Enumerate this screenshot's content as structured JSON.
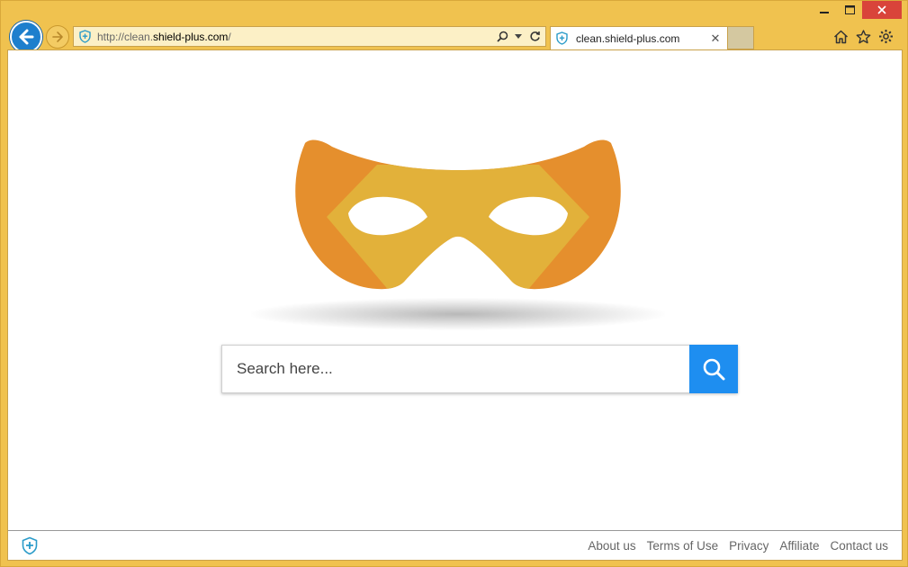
{
  "browser": {
    "address": {
      "url_prefix": "http://clean.",
      "url_host": "shield-plus.com",
      "url_suffix": "/"
    },
    "tab": {
      "title": "clean.shield-plus.com",
      "close_glyph": "✕"
    },
    "window_controls": {
      "minimize": "—",
      "maximize": "☐",
      "close": "✕"
    },
    "icons": {
      "back": "back-arrow-icon",
      "forward": "forward-arrow-icon",
      "site_shield": "shield-icon",
      "search": "search-icon",
      "dropdown": "chevron-down-icon",
      "refresh": "refresh-icon",
      "home": "home-icon",
      "favorites": "star-icon",
      "settings": "gear-icon"
    }
  },
  "page": {
    "search": {
      "placeholder": "Search here..."
    },
    "footer": {
      "links": [
        "About us",
        "Terms of Use",
        "Privacy",
        "Affiliate",
        "Contact us"
      ]
    },
    "colors": {
      "mask_dark": "#e58f2d",
      "mask_light": "#e2b13a",
      "search_button": "#1e8ef0",
      "browser_chrome": "#f0c24f"
    }
  }
}
